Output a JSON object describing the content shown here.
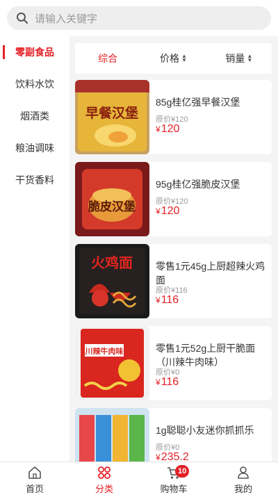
{
  "search": {
    "placeholder": "请输入关键字",
    "icon": "search-icon"
  },
  "sidebar": {
    "items": [
      {
        "label": "零副食品",
        "active": true
      },
      {
        "label": "饮料水饮"
      },
      {
        "label": "烟酒类"
      },
      {
        "label": "粮油调味"
      },
      {
        "label": "干货香料"
      }
    ]
  },
  "sort": {
    "general": "综合",
    "price": "价格",
    "sales": "销量"
  },
  "products": [
    {
      "name": "85g桂亿强早餐汉堡",
      "orig_label": "原价",
      "orig_currency": "¥",
      "orig_price": "120",
      "currency": "¥",
      "price": "120",
      "image_text": "早餐汉堡"
    },
    {
      "name": "95g桂亿强脆皮汉堡",
      "orig_label": "原价",
      "orig_currency": "¥",
      "orig_price": "120",
      "currency": "¥",
      "price": "120",
      "image_text": "脆皮汉堡"
    },
    {
      "name": "零售1元45g上厨超辣火鸡面",
      "orig_label": "原价",
      "orig_currency": "¥",
      "orig_price": "116",
      "currency": "¥",
      "price": "116",
      "image_text": "火鸡面"
    },
    {
      "name": "零售1元52g上厨干脆面（川辣牛肉味）",
      "orig_label": "原价",
      "orig_currency": "¥",
      "orig_price": "0",
      "currency": "¥",
      "price": "116",
      "image_text": "川辣牛肉味"
    },
    {
      "name": "1g聪聪小友迷你抓抓乐",
      "orig_label": "原价",
      "orig_currency": "¥",
      "orig_price": "0",
      "currency": "¥",
      "price": "235.2",
      "image_text": ""
    }
  ],
  "tabbar": {
    "home": "首页",
    "category": "分类",
    "cart": "购物车",
    "cart_badge": "10",
    "mine": "我的"
  },
  "colors": {
    "accent": "#e42026",
    "bg": "#f4f4f4"
  }
}
